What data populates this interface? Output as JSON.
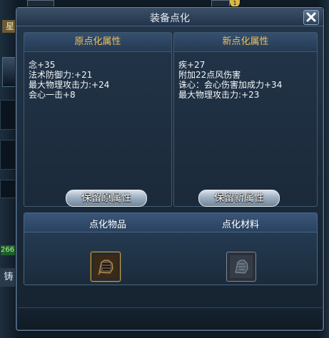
{
  "dialog": {
    "title": "装备点化"
  },
  "original": {
    "header": "原点化属性",
    "stats": [
      "念+35",
      "法术防御力:+21",
      "最大物理攻击力:+24",
      "会心一击+8"
    ],
    "keep_button": "保留原属性"
  },
  "new": {
    "header": "新点化属性",
    "stats": [
      "疾+27",
      "附加22点风伤害",
      "诛心：会心伤害加成力+34",
      "最大物理攻击力:+23"
    ],
    "keep_button": "保留新属性"
  },
  "lower": {
    "item_label": "点化物品",
    "material_label": "点化材料"
  },
  "background": {
    "star_label": "星",
    "green_value": "266",
    "cast_label": "铸",
    "coin_count": "1"
  },
  "colors": {
    "header_gold": "#f0c15a",
    "stat_text": "#f3f6f9"
  },
  "icons": {
    "close": "close-icon",
    "item": "gauntlet-icon",
    "material": "gauntlet-icon"
  }
}
